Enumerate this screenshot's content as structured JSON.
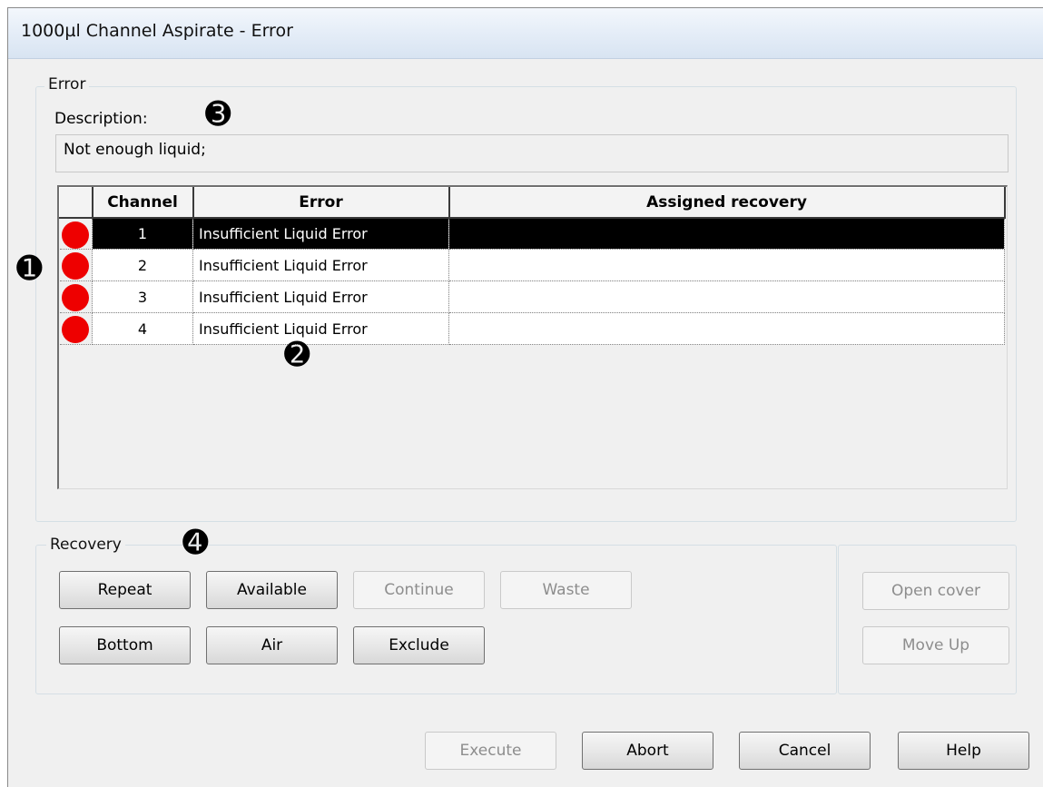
{
  "window": {
    "title": "1000µl Channel Aspirate - Error"
  },
  "error_group": {
    "label": "Error",
    "description_label": "Description:",
    "description_value": "Not enough liquid;"
  },
  "grid": {
    "columns": [
      "",
      "Channel",
      "Error",
      "Assigned recovery"
    ],
    "rows": [
      {
        "status": "red",
        "channel": "1",
        "error": "Insufficient Liquid Error",
        "recovery": "",
        "selected": true
      },
      {
        "status": "red",
        "channel": "2",
        "error": "Insufficient Liquid Error",
        "recovery": "",
        "selected": false
      },
      {
        "status": "red",
        "channel": "3",
        "error": "Insufficient Liquid Error",
        "recovery": "",
        "selected": false
      },
      {
        "status": "red",
        "channel": "4",
        "error": "Insufficient Liquid Error",
        "recovery": "",
        "selected": false
      }
    ]
  },
  "recovery_group": {
    "label": "Recovery",
    "buttons": {
      "repeat": "Repeat",
      "available": "Available",
      "continue": "Continue",
      "waste": "Waste",
      "bottom": "Bottom",
      "air": "Air",
      "exclude": "Exclude",
      "open_cover": "Open cover",
      "move_up": "Move Up"
    }
  },
  "footer": {
    "execute": "Execute",
    "abort": "Abort",
    "cancel": "Cancel",
    "help": "Help"
  },
  "annotations": [
    "➊",
    "➋",
    "➌",
    "➍"
  ],
  "colors": {
    "status_red": "#ee0000",
    "selected_row": "#000000",
    "dialog_bg": "#f0f0f0"
  }
}
